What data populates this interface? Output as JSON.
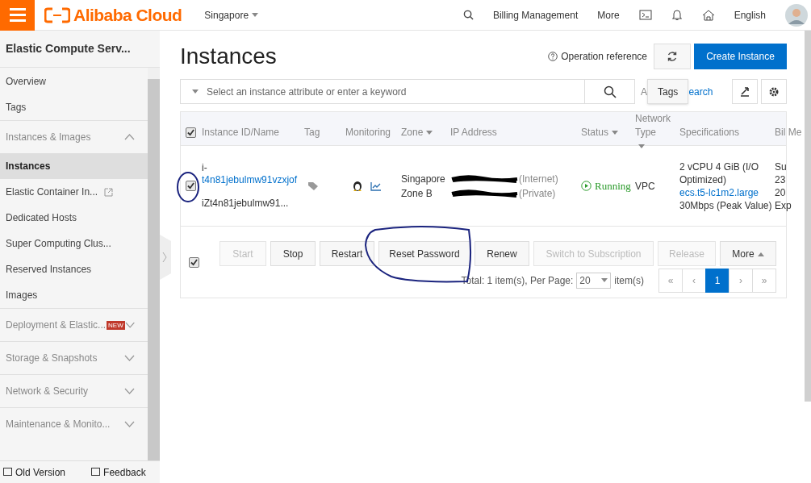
{
  "top_bar": {
    "brand": "Alibaba Cloud",
    "region": "Singapore",
    "links": [
      "Billing Management",
      "More"
    ],
    "language": "English"
  },
  "sidebar": {
    "title": "Elastic Compute Serv...",
    "items": [
      {
        "kind": "link",
        "label": "Overview",
        "selected": false,
        "external": false
      },
      {
        "kind": "link",
        "label": "Tags",
        "selected": false,
        "external": false
      },
      {
        "kind": "group",
        "label": "Instances & Images",
        "expanded": true
      },
      {
        "kind": "link",
        "label": "Instances",
        "selected": true,
        "external": false
      },
      {
        "kind": "link",
        "label": "Elastic Container In...",
        "selected": false,
        "external": true
      },
      {
        "kind": "link",
        "label": "Dedicated Hosts",
        "selected": false,
        "external": false
      },
      {
        "kind": "link",
        "label": "Super Computing Clus...",
        "selected": false,
        "external": false
      },
      {
        "kind": "link",
        "label": "Reserved Instances",
        "selected": false,
        "external": false
      },
      {
        "kind": "link",
        "label": "Images",
        "selected": false,
        "external": false
      },
      {
        "kind": "group",
        "label": "Deployment & Elastic...",
        "expanded": false,
        "badge": "NEW"
      },
      {
        "kind": "group",
        "label": "Storage & Snapshots",
        "expanded": false
      },
      {
        "kind": "group",
        "label": "Network & Security",
        "expanded": false
      },
      {
        "kind": "group",
        "label": "Maintenance & Monito...",
        "expanded": false
      }
    ],
    "footer": [
      "Old Version",
      "Feedback"
    ]
  },
  "page": {
    "title": "Instances",
    "operation_reference": "Operation reference",
    "create_button": "Create Instance"
  },
  "search": {
    "placeholder": "Select an instance attribute or enter a keyword",
    "advanced_parts": [
      "A",
      "earch"
    ],
    "tooltip": "Tags"
  },
  "table": {
    "header_checked": true,
    "columns": [
      {
        "label": "Instance ID/Name",
        "sortable": false
      },
      {
        "label": "Tag",
        "sortable": false
      },
      {
        "label": "Monitoring",
        "sortable": false
      },
      {
        "label": "Zone",
        "sortable": true
      },
      {
        "label": "IP Address",
        "sortable": false
      },
      {
        "label": "Status",
        "sortable": true
      },
      {
        "label": "Network Type",
        "sortable": true
      },
      {
        "label": "Specifications",
        "sortable": false
      },
      {
        "label": "Bil Me",
        "sortable": false
      }
    ],
    "rows": [
      {
        "checked": true,
        "id_prefix": "i-",
        "id": "t4n81jebulmw91vzxjof",
        "name": "iZt4n81jebulmw91...",
        "zone": [
          "Singapore",
          "Zone B"
        ],
        "ip": [
          "(Internet)",
          "(Private)"
        ],
        "status": "Running",
        "network": "VPC",
        "specs": [
          {
            "kind": "text",
            "text": "2 vCPU 4 GiB (I/O Optimized)"
          },
          {
            "kind": "link",
            "text": "ecs.t5-lc1m2.large"
          },
          {
            "kind": "text",
            "text": "30Mbps (Peak Value)"
          }
        ],
        "column_9": [
          "Su",
          "23",
          "20",
          "Exp"
        ]
      }
    ]
  },
  "actions": {
    "checked": true,
    "buttons": [
      {
        "label": "Start",
        "disabled": true,
        "circled": false
      },
      {
        "label": "Stop",
        "disabled": false,
        "circled": false
      },
      {
        "label": "Restart",
        "disabled": false,
        "circled": false
      },
      {
        "label": "Reset Password",
        "disabled": false,
        "circled": true
      },
      {
        "label": "Renew",
        "disabled": false,
        "circled": false
      },
      {
        "label": "Switch to Subscription",
        "disabled": true,
        "circled": false
      },
      {
        "label": "Release",
        "disabled": true,
        "circled": false
      },
      {
        "label": "More",
        "disabled": false,
        "circled": false
      }
    ]
  },
  "pagination": {
    "total": "Total: 1 item(s), Per Page:",
    "per_page": "20",
    "unit": "item(s)",
    "pages": [
      {
        "label": "«",
        "selected": false
      },
      {
        "label": "‹",
        "selected": false
      },
      {
        "label": "1",
        "selected": true
      },
      {
        "label": "›",
        "selected": false
      },
      {
        "label": "»",
        "selected": false
      }
    ]
  }
}
